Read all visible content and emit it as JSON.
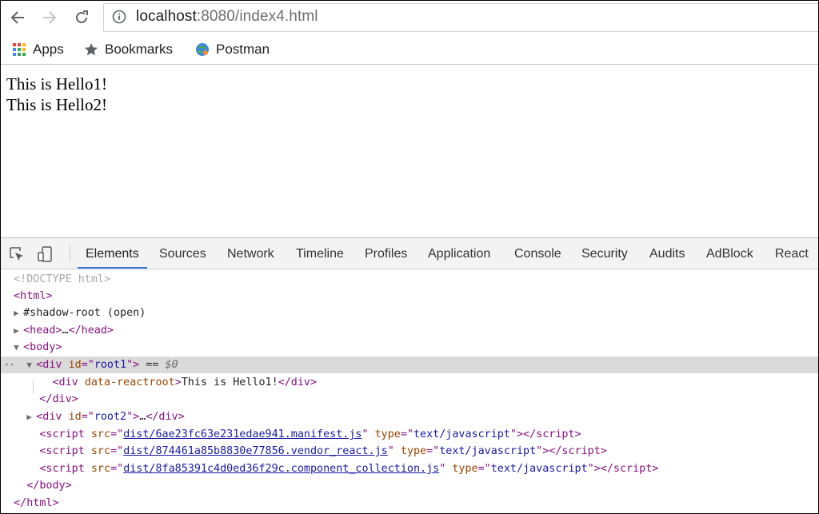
{
  "browser": {
    "url_host": "localhost",
    "url_rest": ":8080/index4.html",
    "bookmarks": [
      {
        "label": "Apps",
        "icon": "apps-grid-icon"
      },
      {
        "label": "Bookmarks",
        "icon": "star-icon"
      },
      {
        "label": "Postman",
        "icon": "postman-globe-icon"
      }
    ]
  },
  "page": {
    "lines": [
      "This is Hello1!",
      "This is Hello2!"
    ]
  },
  "devtools": {
    "tabs": [
      "Elements",
      "Sources",
      "Network",
      "Timeline",
      "Profiles",
      "Application",
      "Console",
      "Security",
      "Audits",
      "AdBlock",
      "React"
    ],
    "active_tab": "Elements",
    "dom": {
      "doctype": "<!DOCTYPE html>",
      "shadow_root": "#shadow-root (open)",
      "root1_id": "root1",
      "selected_marker": "== $0",
      "reactroot_attr": "data-reactroot",
      "reactroot_text": "This is Hello1!",
      "root2_id": "root2",
      "ellipsis": "…",
      "scripts": [
        {
          "src": "dist/6ae23fc63e231edae941.manifest.js",
          "type": "text/javascript"
        },
        {
          "src": "dist/874461a85b8830e77856.vendor_react.js",
          "type": "text/javascript"
        },
        {
          "src": "dist/8fa85391c4d0ed36f29c.component_collection.js",
          "type": "text/javascript"
        }
      ]
    }
  },
  "colors": {
    "tag": "#881280",
    "attr_name": "#994500",
    "attr_value": "#1a1aa6",
    "active_tab_underline": "#3879d9",
    "selected_row": "#dadada"
  }
}
